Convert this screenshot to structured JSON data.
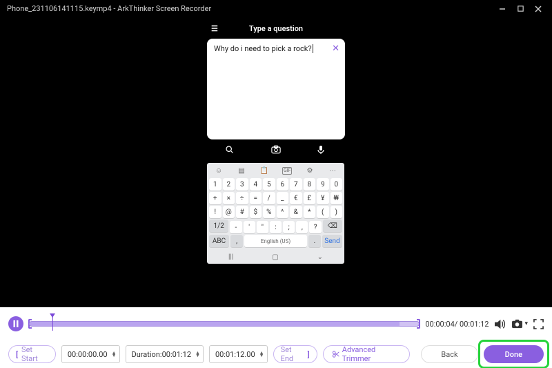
{
  "titlebar": {
    "filename": "Phone_231106141115.keymp4  -  ArkThinker Screen Recorder"
  },
  "phone": {
    "header_title": "Type a question",
    "search_text": "Why do i need to pick a rock?",
    "keyboard": {
      "row1": [
        "1",
        "2",
        "3",
        "4",
        "5",
        "6",
        "7",
        "8",
        "9",
        "0"
      ],
      "row2": [
        "+",
        "×",
        "÷",
        "=",
        "/",
        "_",
        "€",
        "£",
        "¥",
        "₩"
      ],
      "row3": [
        "!",
        "@",
        "#",
        "$",
        "%",
        "^",
        "&",
        "*",
        "(",
        ")"
      ],
      "row4_left": "1/2",
      "row4_mid": [
        "-",
        "'",
        "\"",
        ":",
        ";",
        ",",
        "?"
      ],
      "row4_right": "⌫",
      "row5_abc": "ABC",
      "row5_lang": ",",
      "row5_space": "English (US)",
      "row5_dot": ".",
      "row5_send": "Send"
    }
  },
  "timeline": {
    "current": "00:00:04",
    "total": "00:01:12"
  },
  "controls": {
    "set_start": "Set Start",
    "start_time": "00:00:00.00",
    "duration_label": "Duration:",
    "duration_value": "00:01:12",
    "end_time": "00:01:12.00",
    "set_end": "Set End",
    "advanced": "Advanced Trimmer",
    "back": "Back",
    "done": "Done"
  }
}
